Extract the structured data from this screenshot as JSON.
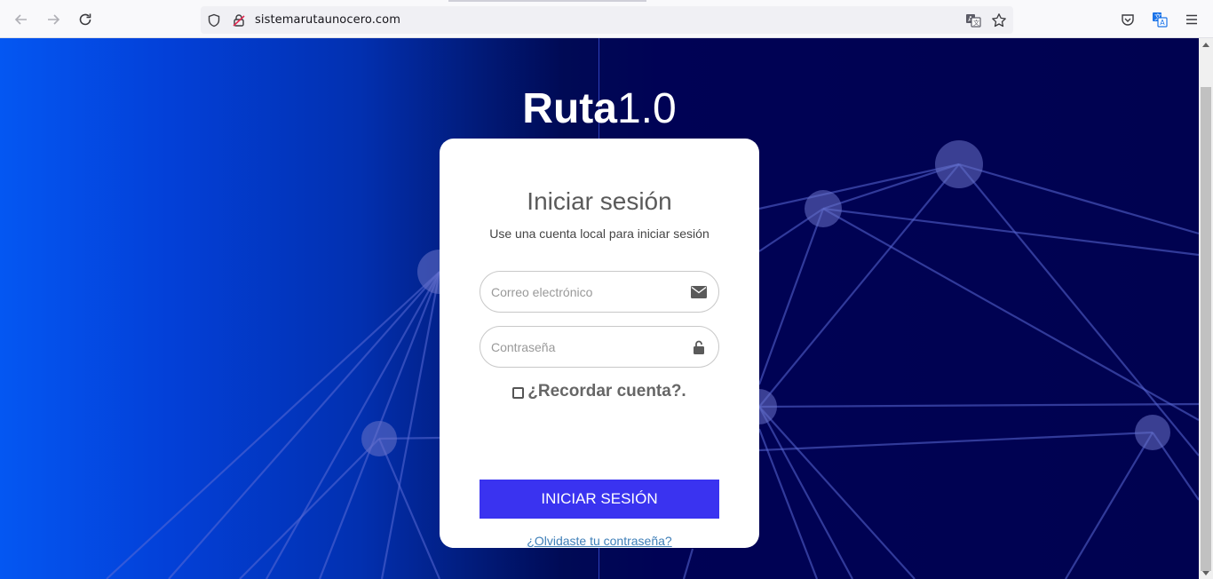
{
  "browser": {
    "url": "sistemarutaunocero.com",
    "icons": [
      "back-arrow-icon",
      "forward-arrow-icon",
      "reload-icon",
      "shield-icon",
      "insecure-lock-icon",
      "translate-icon",
      "bookmark-star-icon",
      "pocket-icon",
      "extension-translate-icon",
      "menu-icon"
    ]
  },
  "page": {
    "brand_bold": "Ruta",
    "brand_light": "1.0",
    "colors": {
      "accent": "#3a33f0",
      "background_left": "#0457f2",
      "background_right": "#000250"
    }
  },
  "login": {
    "title": "Iniciar sesión",
    "subtitle": "Use una cuenta local para iniciar sesión",
    "email_placeholder": "Correo electrónico",
    "email_value": "",
    "password_placeholder": "Contraseña",
    "password_value": "",
    "remember_label": "¿Recordar cuenta?.",
    "remember_checked": false,
    "submit_label": "INICIAR SESIÓN",
    "forgot_label": "¿Olvidaste tu contraseña?"
  }
}
